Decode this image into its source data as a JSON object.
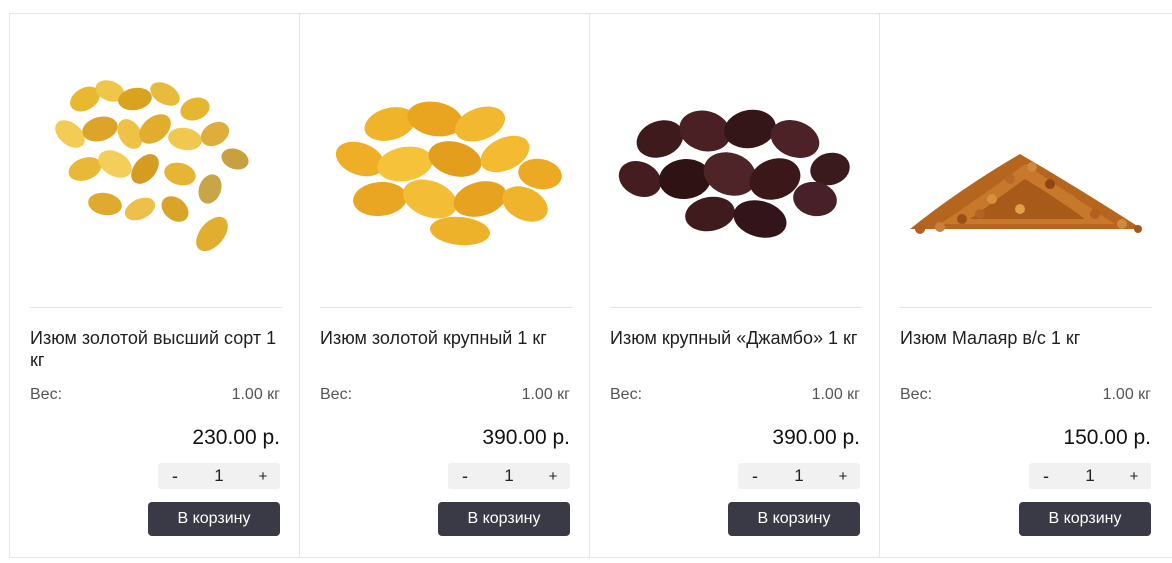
{
  "products": [
    {
      "name": "Изюм золотой высший сорт 1 кг",
      "weight_label": "Вес:",
      "weight_value": "1.00 кг",
      "price": "230.00 р.",
      "quantity": "1",
      "minus_label": "-",
      "plus_label": "+",
      "cart_label": "В корзину",
      "image": "golden-raisins-image"
    },
    {
      "name": "Изюм золотой крупный 1 кг",
      "weight_label": "Вес:",
      "weight_value": "1.00 кг",
      "price": "390.00 р.",
      "quantity": "1",
      "minus_label": "-",
      "plus_label": "+",
      "cart_label": "В корзину",
      "image": "large-golden-raisins-image"
    },
    {
      "name": "Изюм крупный «Джамбо» 1 кг",
      "weight_label": "Вес:",
      "weight_value": "1.00 кг",
      "price": "390.00 р.",
      "quantity": "1",
      "minus_label": "-",
      "plus_label": "+",
      "cart_label": "В корзину",
      "image": "jumbo-dark-raisins-image"
    },
    {
      "name": "Изюм Малаяр в/с 1 кг",
      "weight_label": "Вес:",
      "weight_value": "1.00 кг",
      "price": "150.00 р.",
      "quantity": "1",
      "minus_label": "-",
      "plus_label": "+",
      "cart_label": "В корзину",
      "image": "malayar-raisins-image"
    }
  ],
  "colors": {
    "button_bg": "#3a3a46",
    "qty_bg": "#f1f1f1",
    "border": "#e6e6e6"
  }
}
